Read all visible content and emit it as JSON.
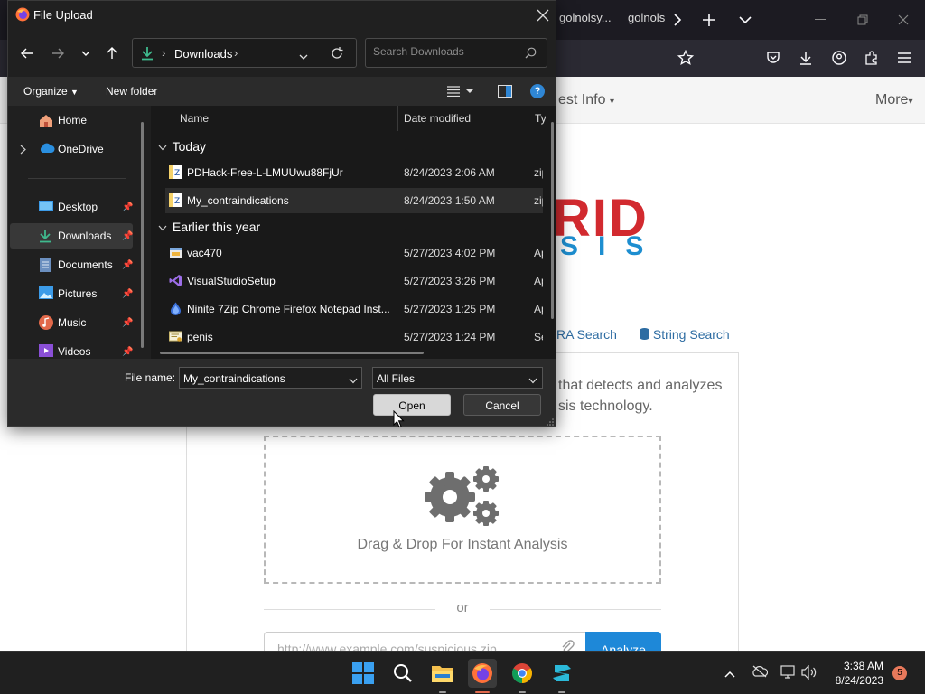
{
  "browser": {
    "tabs": [
      "golnolsy...",
      "golnols"
    ],
    "site_nav": {
      "latest_info": "est Info",
      "more": "More"
    },
    "logo_text": "RID",
    "logo_sub": "SIS",
    "search_links": {
      "yara": "RA Search",
      "string": "String Search"
    },
    "tagline_line1": "that detects and analyzes",
    "tagline_line2": "sis technology.",
    "dropzone_label": "Drag & Drop For Instant Analysis",
    "or_text": "or",
    "url_placeholder": "http://www.example.com/suspicious.zip",
    "analyze_label": "Analyze"
  },
  "dialog": {
    "title": "File Upload",
    "address": "Downloads",
    "search_placeholder": "Search Downloads",
    "commands": {
      "organize": "Organize",
      "new_folder": "New folder"
    },
    "nav_items": [
      {
        "label": "Home"
      },
      {
        "label": "OneDrive"
      },
      {
        "label": "Desktop"
      },
      {
        "label": "Downloads"
      },
      {
        "label": "Documents"
      },
      {
        "label": "Pictures"
      },
      {
        "label": "Music"
      },
      {
        "label": "Videos"
      }
    ],
    "columns": {
      "name": "Name",
      "date": "Date modified",
      "type": "Ty"
    },
    "groups": [
      {
        "label": "Today",
        "files": [
          {
            "name": "PDHack-Free-L-LMUUwu88FjUr",
            "date": "8/24/2023 2:06 AM",
            "type": "zip",
            "icon": "zip-archive-icon"
          },
          {
            "name": "My_contraindications",
            "date": "8/24/2023 1:50 AM",
            "type": "zip",
            "icon": "zip-archive-icon"
          }
        ]
      },
      {
        "label": "Earlier this year",
        "files": [
          {
            "name": "vac470",
            "date": "5/27/2023 4:02 PM",
            "type": "Ap",
            "icon": "installer-icon"
          },
          {
            "name": "VisualStudioSetup",
            "date": "5/27/2023 3:26 PM",
            "type": "Ap",
            "icon": "visual-studio-icon"
          },
          {
            "name": "Ninite 7Zip Chrome Firefox Notepad Inst...",
            "date": "5/27/2023 1:25 PM",
            "type": "Ap",
            "icon": "ninite-icon"
          },
          {
            "name": "penis",
            "date": "5/27/2023 1:24 PM",
            "type": "Se",
            "icon": "certificate-icon"
          }
        ]
      }
    ],
    "file_name_label": "File name:",
    "file_name_value": "My_contraindications",
    "file_type": "All Files",
    "open_label": "Open",
    "cancel_label": "Cancel"
  },
  "taskbar": {
    "time": "3:38 AM",
    "date": "8/24/2023",
    "notification_count": "5"
  },
  "colors": {
    "logo_red": "#d22a2f",
    "logo_blue": "#1d8ed0",
    "analyze_blue": "#1e88d8",
    "dialog_bg": "#202020",
    "taskbar_bg": "#202020"
  }
}
